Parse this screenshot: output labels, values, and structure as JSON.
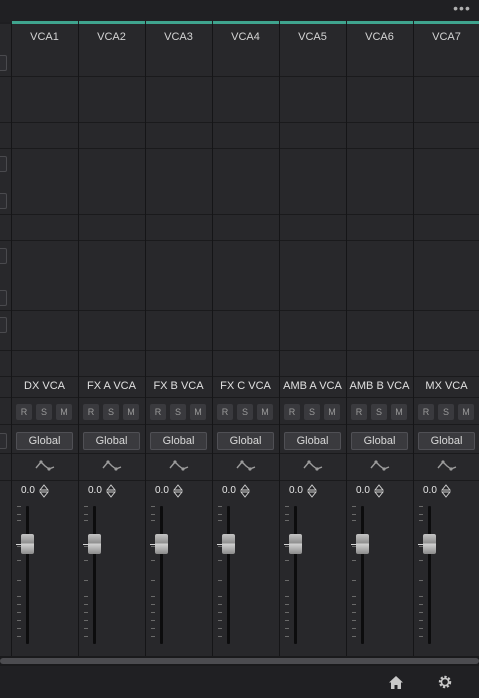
{
  "toolbar": {
    "more_icon": "more-icon"
  },
  "vca_headers": [
    "VCA1",
    "VCA2",
    "VCA3",
    "VCA4",
    "VCA5",
    "VCA6",
    "VCA7"
  ],
  "strips": [
    {
      "name": "DX VCA",
      "r": "R",
      "s": "S",
      "m": "M",
      "global": "Global",
      "volume": "0.0"
    },
    {
      "name": "FX A VCA",
      "r": "R",
      "s": "S",
      "m": "M",
      "global": "Global",
      "volume": "0.0"
    },
    {
      "name": "FX B VCA",
      "r": "R",
      "s": "S",
      "m": "M",
      "global": "Global",
      "volume": "0.0"
    },
    {
      "name": "FX C VCA",
      "r": "R",
      "s": "S",
      "m": "M",
      "global": "Global",
      "volume": "0.0"
    },
    {
      "name": "AMB A VCA",
      "r": "R",
      "s": "S",
      "m": "M",
      "global": "Global",
      "volume": "0.0"
    },
    {
      "name": "AMB B VCA",
      "r": "R",
      "s": "S",
      "m": "M",
      "global": "Global",
      "volume": "0.0"
    },
    {
      "name": "MX VCA",
      "r": "R",
      "s": "S",
      "m": "M",
      "global": "Global",
      "volume": "0.0"
    }
  ],
  "footer": {
    "home_icon": "home-icon",
    "settings_icon": "gear-icon"
  },
  "colors": {
    "accent": "#3fa48e",
    "background": "#28282b"
  }
}
